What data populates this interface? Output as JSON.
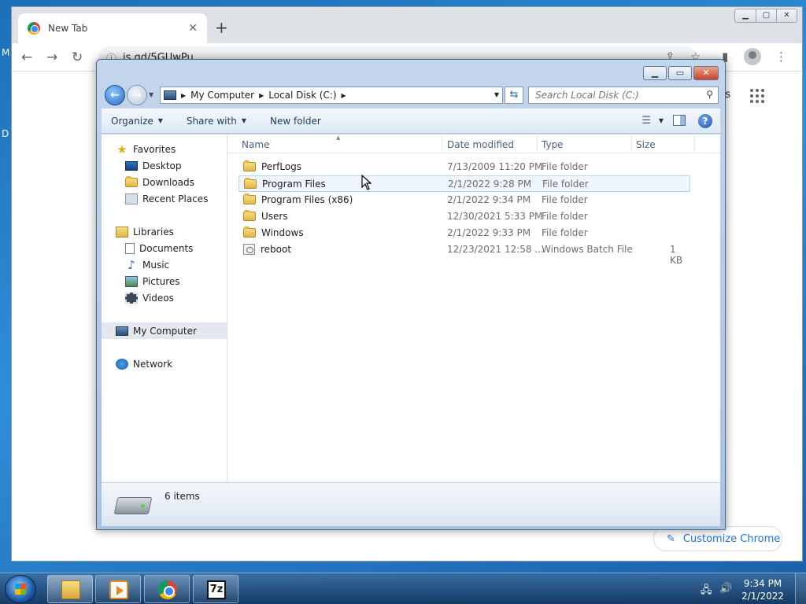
{
  "desktop": {
    "edge_text_1": "M",
    "edge_text_2": "D"
  },
  "chrome": {
    "tab_title": "New Tab",
    "url": "is.gd/5GUwPu",
    "images_link_partial": "ges",
    "customize_label": "Customize Chrome"
  },
  "explorer": {
    "breadcrumb": [
      "My Computer",
      "Local Disk (C:)"
    ],
    "search_placeholder": "Search Local Disk (C:)",
    "commands": {
      "organize": "Organize",
      "share_with": "Share with",
      "new_folder": "New folder"
    },
    "nav": {
      "favorites": "Favorites",
      "favorites_items": [
        "Desktop",
        "Downloads",
        "Recent Places"
      ],
      "libraries": "Libraries",
      "libraries_items": [
        "Documents",
        "Music",
        "Pictures",
        "Videos"
      ],
      "computer": "My Computer",
      "network": "Network"
    },
    "columns": {
      "name": "Name",
      "date": "Date modified",
      "type": "Type",
      "size": "Size"
    },
    "files": [
      {
        "name": "PerfLogs",
        "date": "7/13/2009 11:20 PM",
        "type": "File folder",
        "size": ""
      },
      {
        "name": "Program Files",
        "date": "2/1/2022 9:28 PM",
        "type": "File folder",
        "size": ""
      },
      {
        "name": "Program Files (x86)",
        "date": "2/1/2022 9:34 PM",
        "type": "File folder",
        "size": ""
      },
      {
        "name": "Users",
        "date": "12/30/2021 5:33 PM",
        "type": "File folder",
        "size": ""
      },
      {
        "name": "Windows",
        "date": "2/1/2022 9:33 PM",
        "type": "File folder",
        "size": ""
      },
      {
        "name": "reboot",
        "date": "12/23/2021 12:58 ...",
        "type": "Windows Batch File",
        "size": "1 KB"
      }
    ],
    "status": "6 items"
  },
  "taskbar": {
    "apps": [
      "explorer-icon",
      "media-player-icon",
      "chrome-icon",
      "7zip-icon"
    ],
    "seven_zip_label": "7z",
    "time": "9:34 PM",
    "date": "2/1/2022"
  }
}
